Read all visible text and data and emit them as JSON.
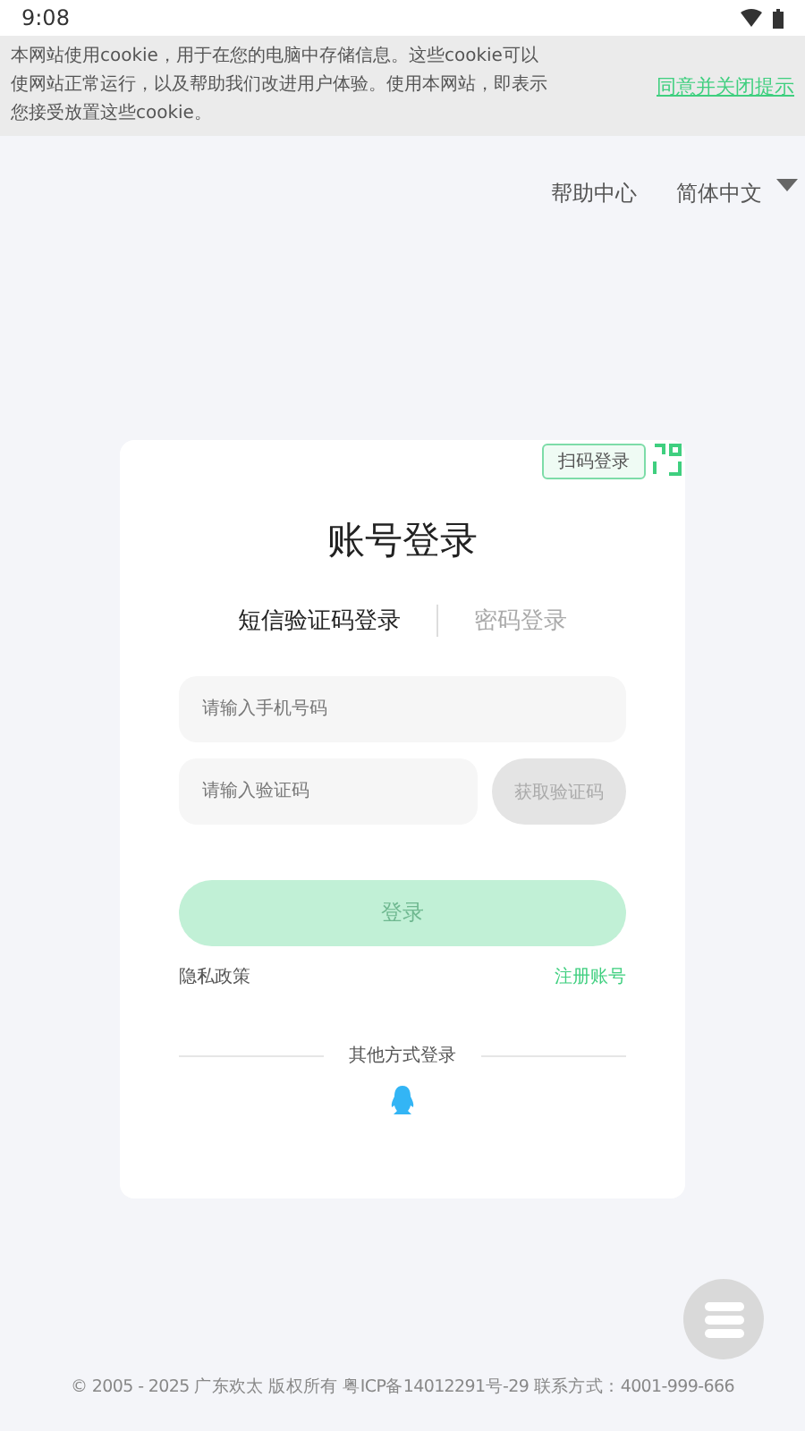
{
  "status_bar": {
    "time": "9:08"
  },
  "cookie_banner": {
    "text": "本网站使用cookie，用于在您的电脑中存储信息。这些cookie可以使网站正常运行，以及帮助我们改进用户体验。使用本网站，即表示您接受放置这些cookie。",
    "accept_link": "同意并关闭提示"
  },
  "top_links": {
    "help": "帮助中心",
    "language": "简体中文"
  },
  "login_card": {
    "qr_tip": "扫码登录",
    "title": "账号登录",
    "tabs": [
      {
        "label": "短信验证码登录",
        "selected": true
      },
      {
        "label": "密码登录",
        "selected": false
      }
    ],
    "phone_field": {
      "placeholder": "请输入手机号码"
    },
    "code_field": {
      "placeholder": "请输入验证码"
    },
    "get_code_button": {
      "label": "获取验证码",
      "disabled": true
    },
    "login_button": {
      "label": "登录",
      "disabled": true
    },
    "privacy_link": "隐私政策",
    "register_link": "注册账号",
    "other_methods": "其他方式登录"
  },
  "footer": "© 2005 - 2025 广东欢太 版权所有 粤ICP备14012291号-29 联系方式：4001-999-666"
}
